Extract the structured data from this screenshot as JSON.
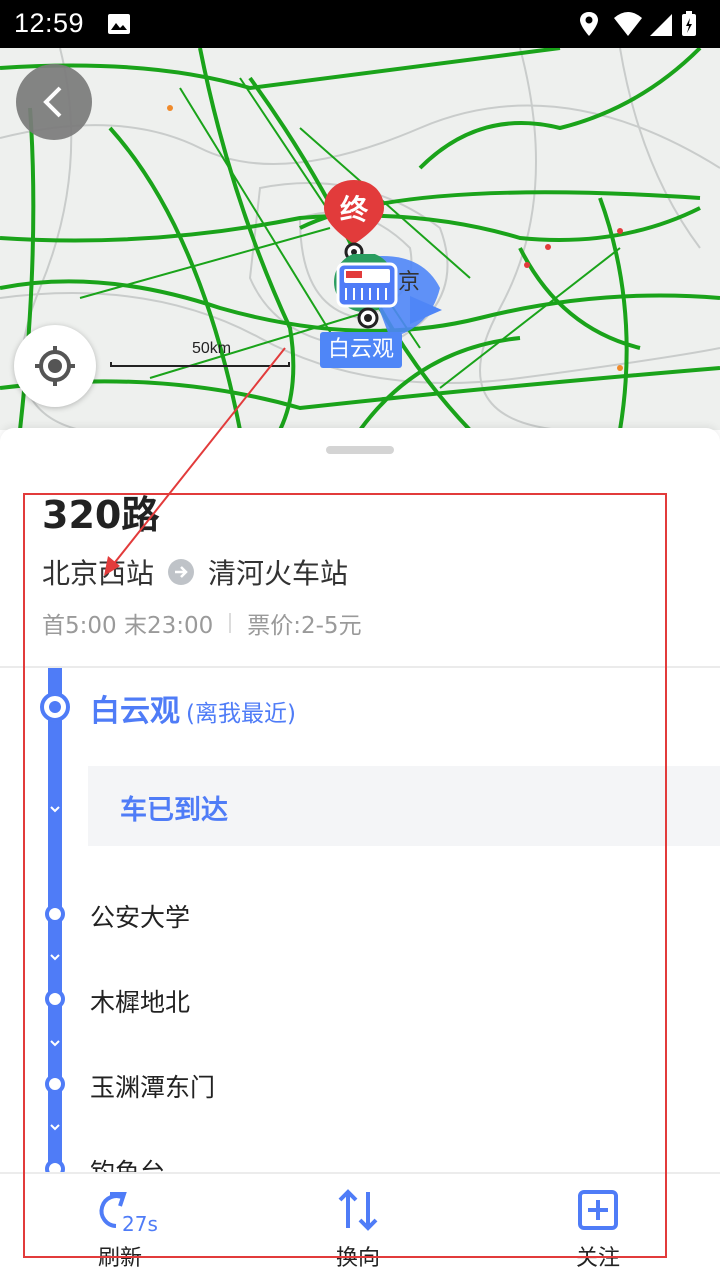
{
  "status_bar": {
    "time": "12:59"
  },
  "map": {
    "end_marker_label": "终",
    "current_stop_tag": "白云观",
    "scale_label": "50km",
    "partial_label": "京"
  },
  "route": {
    "name": "320路",
    "from": "北京西站",
    "to": "清河火车站",
    "hours": "首5:00 末23:00",
    "fare": "票价:2-5元"
  },
  "stops": {
    "current": {
      "name": "白云观",
      "note": "(离我最近)"
    },
    "arrival_status": "车已到达",
    "list": [
      "公安大学",
      "木樨地北",
      "玉渊潭东门",
      "钓鱼台"
    ]
  },
  "toolbar": {
    "refresh_label": "刷新",
    "refresh_countdown": "27s",
    "reverse_label": "换向",
    "follow_label": "关注"
  },
  "colors": {
    "accent": "#4f7cf7",
    "annotation": "#e23b3b",
    "route_line": "#1aa31a"
  }
}
